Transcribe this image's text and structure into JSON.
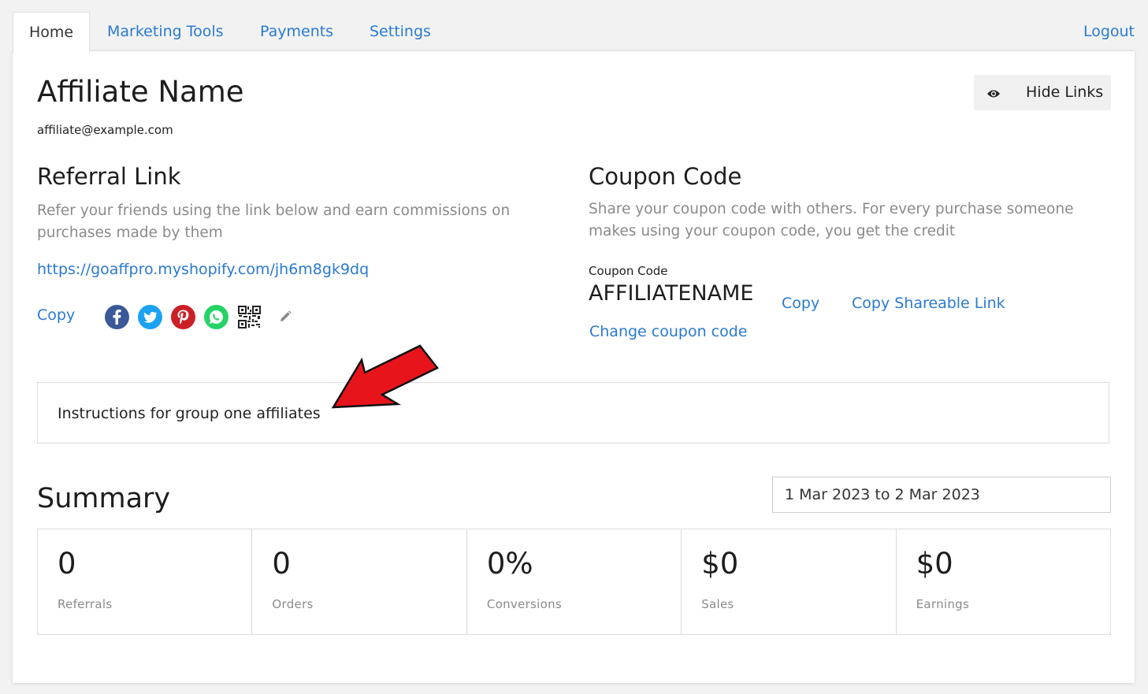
{
  "nav": {
    "tabs": [
      {
        "label": "Home",
        "active": true
      },
      {
        "label": "Marketing Tools"
      },
      {
        "label": "Payments"
      },
      {
        "label": "Settings"
      }
    ],
    "logout_label": "Logout"
  },
  "profile": {
    "name": "Affiliate Name",
    "email": "affiliate@example.com",
    "hide_links_label": "Hide Links",
    "hide_links_icon": "eye-icon"
  },
  "referral": {
    "title": "Referral Link",
    "description": "Refer your friends using the link below and earn commissions on purchases made by them",
    "url": "https://goaffpro.myshopify.com/jh6m8gk9dq",
    "copy_label": "Copy",
    "share_icons": [
      "facebook-icon",
      "twitter-icon",
      "pinterest-icon",
      "whatsapp-icon",
      "qr-code-icon",
      "pencil-icon"
    ],
    "colors": {
      "facebook": "#3b5998",
      "twitter": "#1da1f2",
      "pinterest": "#cb2027",
      "whatsapp": "#25d366"
    }
  },
  "coupon": {
    "title": "Coupon Code",
    "description": "Share your coupon code with others. For every purchase someone makes using your coupon code, you get the credit",
    "label": "Coupon Code",
    "code": "AFFILIATENAME",
    "copy_label": "Copy",
    "copy_shareable_label": "Copy Shareable Link",
    "change_label": "Change coupon code"
  },
  "instructions": {
    "text": "Instructions for group one affiliates",
    "annotation": "red-arrow",
    "annotation_color": "#e8141c"
  },
  "summary": {
    "title": "Summary",
    "date_range": "1 Mar 2023 to 2 Mar 2023",
    "stats": [
      {
        "value": "0",
        "label": "Referrals"
      },
      {
        "value": "0",
        "label": "Orders"
      },
      {
        "value": "0%",
        "label": "Conversions"
      },
      {
        "value": "$0",
        "label": "Sales"
      },
      {
        "value": "$0",
        "label": "Earnings"
      }
    ]
  },
  "theme": {
    "link_color": "#2a7ad2",
    "muted_color": "#8a8a8a"
  }
}
